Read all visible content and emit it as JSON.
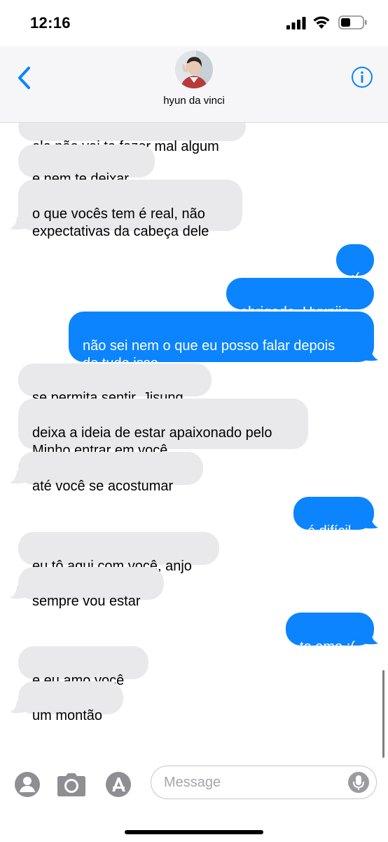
{
  "status_bar": {
    "time": "12:16"
  },
  "header": {
    "contact_name": "hyun da vinci"
  },
  "messages": [
    {
      "text": "ele não vai te fazer mal algum",
      "direction": "incoming"
    },
    {
      "text": "e nem te deixar",
      "direction": "incoming"
    },
    {
      "text": "o que vocês tem é real, não\nexpectativas da cabeça dele",
      "direction": "incoming"
    },
    {
      "text": ":(",
      "direction": "outgoing"
    },
    {
      "text": "obrigado, Hyunjin",
      "direction": "outgoing"
    },
    {
      "text": "não sei nem o que eu posso falar depois\nde tudo isso",
      "direction": "outgoing"
    },
    {
      "text": "se permita sentir, Jisung",
      "direction": "incoming"
    },
    {
      "text": "deixa a ideia de estar apaixonado pelo\nMinho entrar em você",
      "direction": "incoming"
    },
    {
      "text": "até você se acostumar",
      "direction": "incoming"
    },
    {
      "text": "é difícil",
      "direction": "outgoing"
    },
    {
      "text": "eu tô aqui com você, anjo",
      "direction": "incoming"
    },
    {
      "text": "sempre vou estar",
      "direction": "incoming"
    },
    {
      "text": "te amo :(",
      "direction": "outgoing"
    },
    {
      "text": "e eu amo você",
      "direction": "incoming"
    },
    {
      "text": "um montão",
      "direction": "incoming"
    }
  ],
  "composer": {
    "placeholder": "Message"
  },
  "colors": {
    "accent": "#0b84fe",
    "incoming_bubble": "#e9e9eb",
    "header_bg": "#f6f6f8"
  },
  "icons": [
    "back-chevron-icon",
    "info-icon",
    "app-store-icon",
    "camera-icon",
    "apps-icon",
    "microphone-icon"
  ]
}
